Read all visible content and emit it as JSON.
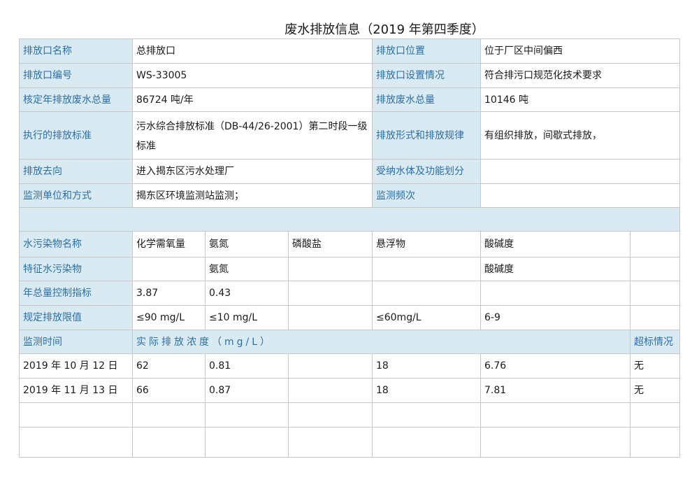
{
  "title": "废水排放信息（2019 年第四季度）",
  "outlet": {
    "name_label": "排放口名称",
    "name_value": "总排放口",
    "position_label": "排放口位置",
    "position_value": "位于厂区中间偏西",
    "code_label": "排放口编号",
    "code_value": "WS-33005",
    "setup_label": "排放口设置情况",
    "setup_value": "符合排污口规范化技术要求",
    "approved_label": "核定年排放废水总量",
    "approved_value": "86724 吨/年",
    "total_label": "排放废水总量",
    "total_value": "10146 吨",
    "standard_label": "执行的排放标准",
    "standard_value": "污水综合排放标准（DB-44/26-2001）第二时段一级标准",
    "form_label": "排放形式和排放规律",
    "form_value": "有组织排放，间歇式排放，",
    "destination_label": "排放去向",
    "destination_value": "进入揭东区污水处理厂",
    "receiving_label": "受纳水体及功能划分",
    "receiving_value": "",
    "monitor_unit_label": "监测单位和方式",
    "monitor_unit_value": "揭东区环境监测站监测；",
    "frequency_label": "监测频次",
    "frequency_value": ""
  },
  "pollutants": {
    "header_label": "水污染物名称",
    "names": [
      "化学需氧量",
      "氨氮",
      "磷酸盐",
      "悬浮物",
      "酸碱度",
      ""
    ],
    "feature_label": "特征水污染物",
    "feature": [
      "",
      "氨氮",
      "",
      "",
      "酸碱度",
      ""
    ],
    "annual_label": "年总量控制指标",
    "annual": [
      "3.87",
      "0.43",
      "",
      "",
      "",
      ""
    ],
    "limit_label": "规定排放限值",
    "limit": [
      "≤90 mg/L",
      "≤10 mg/L",
      "",
      "≤60mg/L",
      "6-9",
      ""
    ]
  },
  "monitoring": {
    "time_label": "监测时间",
    "concentration_label": "实际排放浓度（mg/L）",
    "exceed_label": "超标情况",
    "rows": [
      {
        "date": "2019 年 10 月 12 日",
        "values": [
          "62",
          "0.81",
          "",
          "18",
          "6.76"
        ],
        "exceed": "无"
      },
      {
        "date": "2019 年 11 月 13 日",
        "values": [
          "66",
          "0.87",
          "",
          "18",
          "7.81"
        ],
        "exceed": "无"
      }
    ]
  }
}
